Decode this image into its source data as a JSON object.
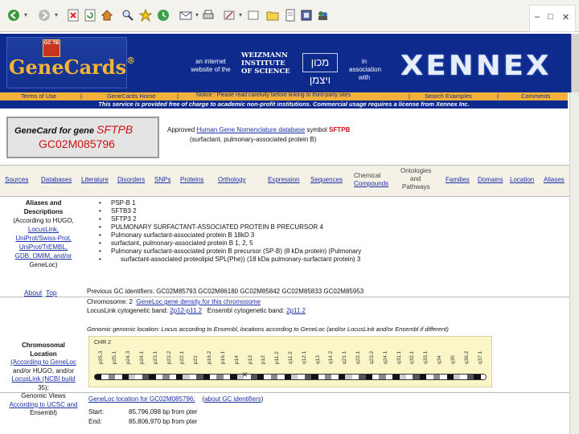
{
  "browser": {
    "window_controls": {
      "minimize": "–",
      "maximize": "□",
      "close": "✕"
    }
  },
  "banner": {
    "genecards_logo": "GeneCards",
    "genecards_mark": "®",
    "logo_box": "GC TB",
    "tagline": "an internet website of the",
    "weizmann": [
      "WEIZMANN",
      "INSTITUTE",
      "OF SCIENCE"
    ],
    "weizmann_hebrew": "מכון ויצמן",
    "assoc": "in association with",
    "xennex": "XENNEX"
  },
  "linkbar": {
    "items": [
      "Terms of Use",
      "|",
      "GeneCards Home",
      "|",
      "Notice : Please read carefully before linking to third-party sites",
      "|",
      "Search Examples",
      "|",
      "Comments"
    ]
  },
  "notice": "This service is provided free of charge to academic non-profit institutions. Commercial usage requires a license from Xennex Inc.",
  "genecard": {
    "label": "GeneCard for gene",
    "symbol": "SFTPB",
    "gc_id": "GC02M085796",
    "approved_prefix": "Approved",
    "approved_link": "Human Gene Nomenclature database",
    "approved_suffix": "symbol",
    "approved_symbol": "SFTPB",
    "full_name": "(surfactant, pulmonary-associated protein B)"
  },
  "sections": [
    "Sources",
    "Databases",
    "Literature",
    "Disorders",
    "SNPs",
    "Proteins",
    "Orthology",
    "Expression",
    "Sequences",
    "Chemical",
    "Compounds",
    "Ontologies",
    "and",
    "Pathways",
    "Families",
    "Domains",
    "Location",
    "Aliases"
  ],
  "aliases": {
    "left_head": [
      "Aliases and",
      "Descriptions"
    ],
    "left_lines": [
      "(According to HUGO,",
      "LocusLink,",
      "UniProt/Swiss-Prot,",
      "UniProt/TrEMBL,",
      "GDB, OMIM, and/or",
      "GeneLoc)"
    ],
    "items": [
      "PSP-B 1",
      "SFTB3 2",
      "SFTP3 2",
      "PULMONARY SURFACTANT-ASSOCIATED PROTEIN B PRECURSOR 4",
      "Pulmonary surfactant-associated protein B 18kD 3",
      "surfactant, pulmonary-associated protein B 1, 2, 5",
      "Pulmonary surfactant-associated protein B precursor (SP-B) (8 kDa protein) (Pulmonary",
      "surfactant-associated proteolipid SPL(Phe)) (18 kDa pulmonary-surfactant protein) 3"
    ],
    "previous_ids": "Previous GC identifiers: GC02M85793 GC02M86180 GC02M85842 GC02M85833 GC02M85953",
    "about": "About",
    "top": "Top"
  },
  "location": {
    "left_head": [
      "Chromosomal",
      "Location"
    ],
    "left_lines": [
      "(According to GeneLoc",
      "and/or HUGO, and/or",
      "LocusLink (NCBI build",
      "35);",
      "Genomic Views",
      "According to UCSC and",
      "Ensembl)"
    ],
    "chromosome": "Chromosome: 2",
    "density_link": "GeneLoc gene density for this chromosome",
    "cyto_label": "LocusLink cytogenetic band:",
    "cyto_value": "2p12-p11.2",
    "ensembl_label": "Ensembl cytogenetic band:",
    "ensembl_value": "2p11.2",
    "genomic_line": "Genomic genomic location: Locus according to Ensembl, locations according to GeneLoc (and/or LocusLink and/or Ensembl if different)",
    "ideogram_title": "CHR 2",
    "band_labels": [
      "p25.3",
      "p25.1",
      "p24.3",
      "p24.1",
      "p23.1",
      "p22.2",
      "p22.1",
      "p21",
      "p16.2",
      "p16.1",
      "p14",
      "p13",
      "p12",
      "p11.2",
      "q11.2",
      "q12.1",
      "q13",
      "q14.2",
      "q21.1",
      "q22.1",
      "q23.2",
      "q24.1",
      "q31.1",
      "q32.1",
      "q33.1",
      "q34",
      "q35",
      "q36.2",
      "q37.1"
    ],
    "genloc_link": "GeneLoc location for GC02M085796:",
    "about_ids": "about GC identifiers",
    "start_label": "Start:",
    "start_value": "85,796,098 bp from pter",
    "end_label": "End:",
    "end_value": "85,806,970 bp from pter"
  }
}
